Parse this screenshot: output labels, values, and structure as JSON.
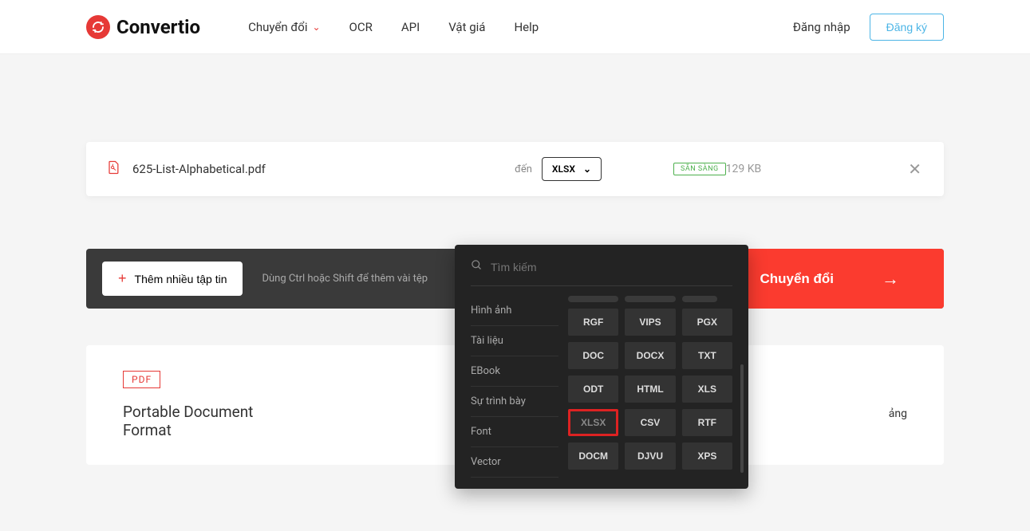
{
  "brand": "Convertio",
  "nav": {
    "convert": "Chuyển đổi",
    "ocr": "OCR",
    "api": "API",
    "pricing": "Vật giá",
    "help": "Help"
  },
  "auth": {
    "login": "Đăng nhập",
    "signup": "Đăng ký"
  },
  "file": {
    "name": "625-List-Alphabetical.pdf",
    "to_label": "đến",
    "selected_format": "XLSX",
    "status": "SẴN SÀNG",
    "size": "129 KB"
  },
  "actions": {
    "add_more": "Thêm nhiều tập tin",
    "hint": "Dùng Ctrl hoặc Shift để thêm vài tệp",
    "convert": "Chuyển đổi"
  },
  "dropdown": {
    "search_placeholder": "Tìm kiếm",
    "categories": [
      "Hình ảnh",
      "Tài liệu",
      "EBook",
      "Sự trình bày",
      "Font",
      "Vector"
    ],
    "formats": [
      [
        "RGF",
        "VIPS",
        "PGX"
      ],
      [
        "DOC",
        "DOCX",
        "TXT"
      ],
      [
        "ODT",
        "HTML",
        "XLS"
      ],
      [
        "XLSX",
        "CSV",
        "RTF"
      ],
      [
        "DOCM",
        "DJVU",
        "XPS"
      ]
    ],
    "selected": "XLSX"
  },
  "info": {
    "badge": "PDF",
    "title": "Portable Document Format",
    "fragment": "ảng"
  }
}
